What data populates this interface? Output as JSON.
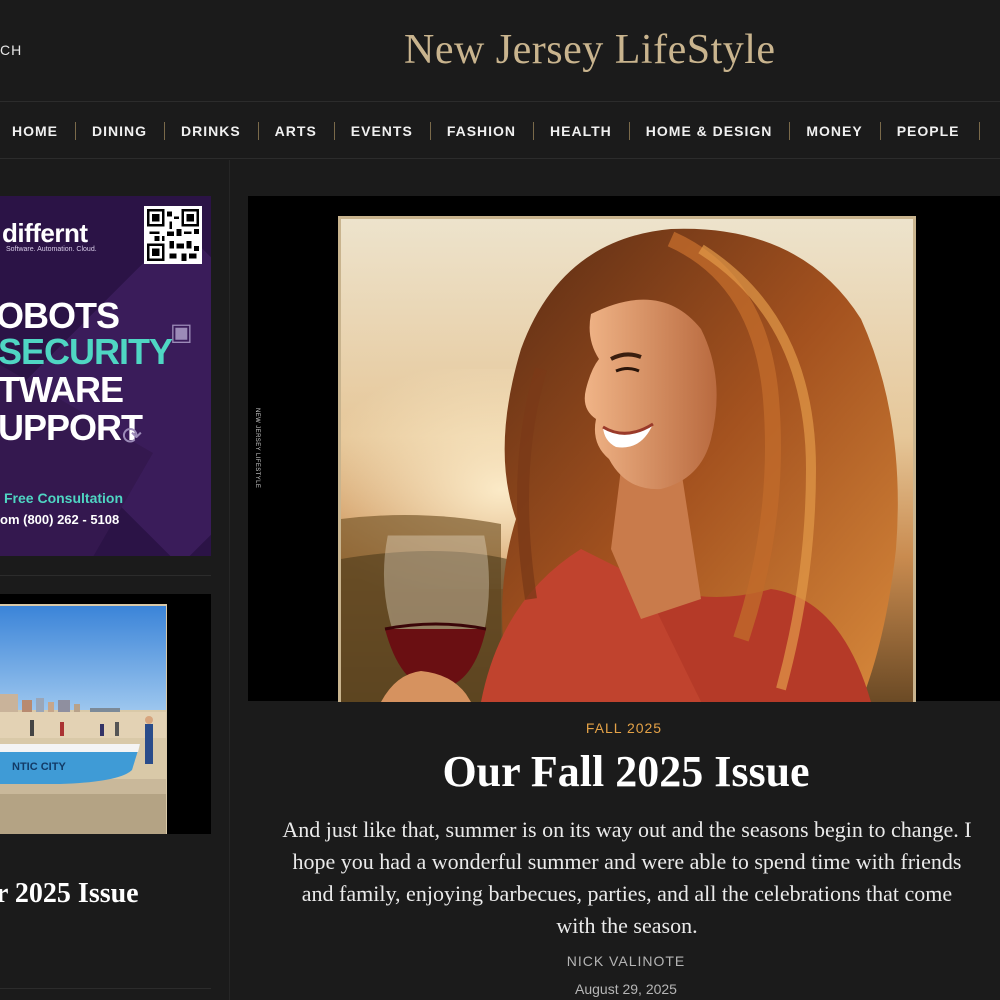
{
  "header": {
    "search_label": "CH",
    "brand": "New Jersey LifeStyle"
  },
  "nav": {
    "items": [
      "HOME",
      "DINING",
      "DRINKS",
      "ARTS",
      "EVENTS",
      "FASHION",
      "HEALTH",
      "HOME & DESIGN",
      "MONEY",
      "PEOPLE"
    ]
  },
  "sidebar": {
    "ad": {
      "logo": "differnt",
      "tagline": "Software. Automation. Cloud.",
      "lines": [
        "OBOTS",
        "SECURITY",
        "TWARE",
        "UPPORT"
      ],
      "cta": "Free Consultation",
      "phone": "om  (800) 262 - 5108",
      "colors": {
        "background": "#2b1346",
        "accent": "#4fd6c3"
      }
    },
    "card": {
      "boat_text": "NTIC CITY",
      "title": "r 2025 Issue"
    }
  },
  "feature": {
    "vertical_label": "NEW JERSEY LIFESTYLE",
    "kicker": "FALL 2025",
    "title": "Our Fall 2025 Issue",
    "excerpt": "And just like that, summer is on its way out and the seasons begin to change. I hope you had a wonderful summer and were able to spend time with friends and family, enjoying barbecues, parties, and all the celebrations that come with the season.",
    "author": "NICK VALINOTE",
    "date": "August 29, 2025"
  },
  "colors": {
    "background": "#1b1b1b",
    "brand_gold": "#c9b48e",
    "kicker_orange": "#e4a247",
    "nav_separator": "#7a6a4a"
  }
}
